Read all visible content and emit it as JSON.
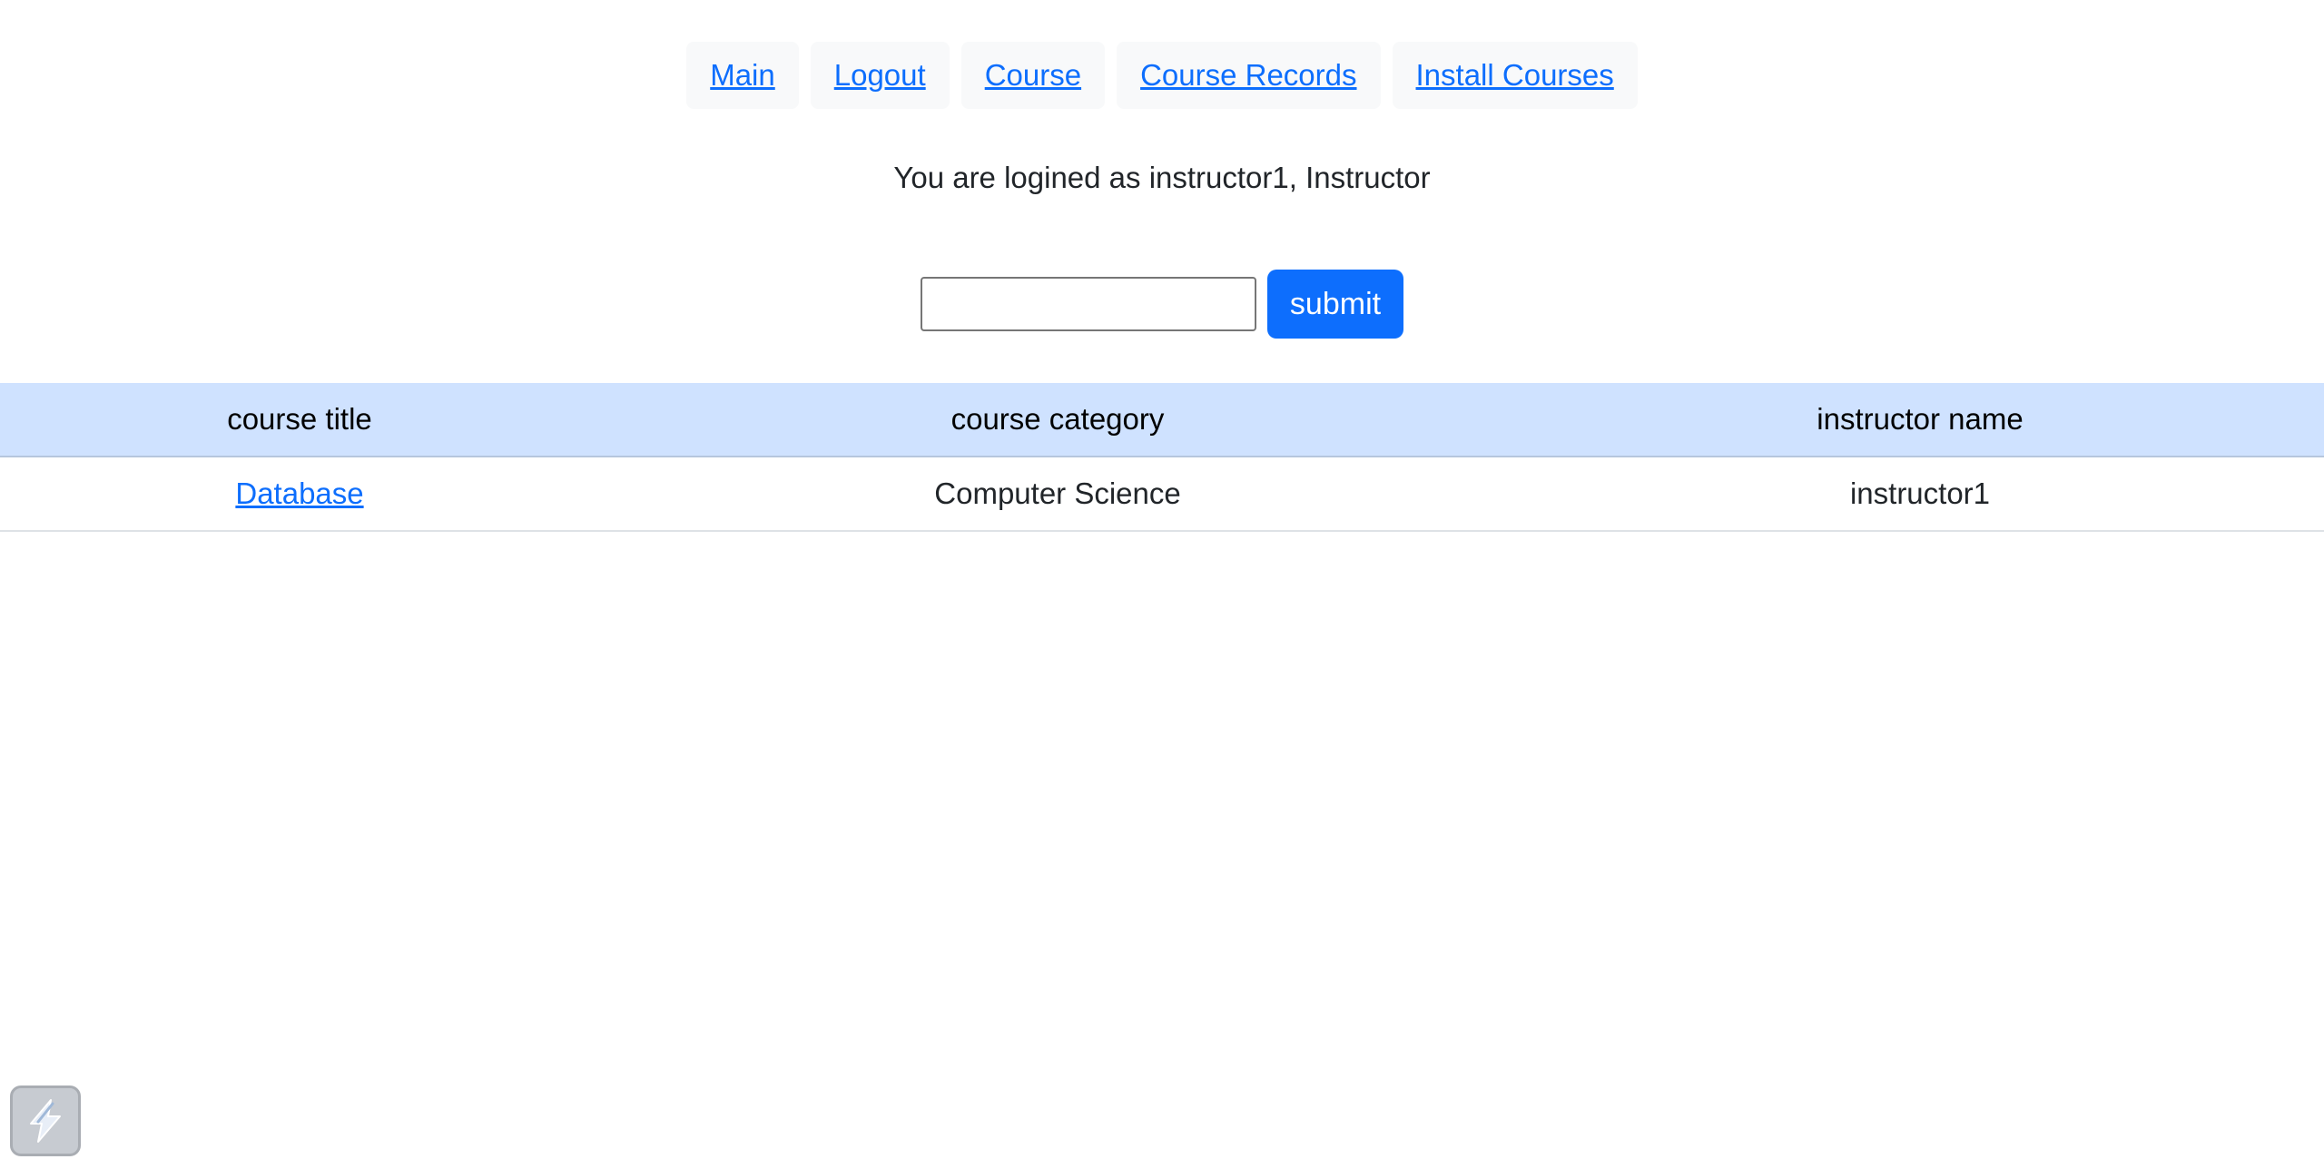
{
  "nav": {
    "items": [
      {
        "label": "Main"
      },
      {
        "label": "Logout"
      },
      {
        "label": "Course"
      },
      {
        "label": "Course Records"
      },
      {
        "label": "Install Courses"
      }
    ]
  },
  "status": {
    "login_text": "You are logined as instructor1, Instructor"
  },
  "search": {
    "value": "",
    "placeholder": "",
    "submit_label": "submit"
  },
  "table": {
    "headers": [
      "course title",
      "course category",
      "instructor name"
    ],
    "rows": [
      {
        "title": "Database",
        "category": "Computer Science",
        "instructor": "instructor1"
      }
    ]
  },
  "widget": {
    "icon": "lightning-bolt-icon"
  },
  "colors": {
    "link": "#0d6efd",
    "primary_button": "#0d6efd",
    "table_header_bg": "#cfe2ff",
    "nav_item_bg": "#f8f9fa"
  }
}
